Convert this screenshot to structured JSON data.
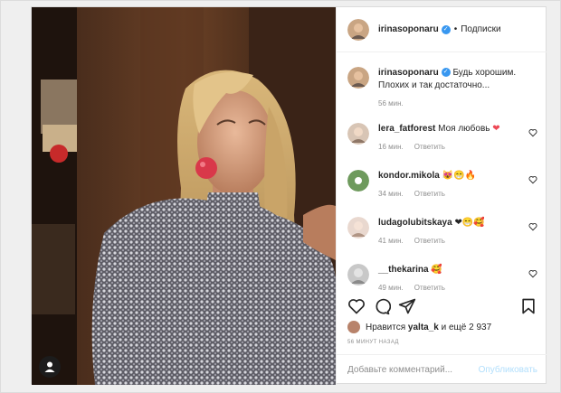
{
  "header": {
    "username": "irinasoponaru",
    "separator": "•",
    "follow_label": "Подписки"
  },
  "caption": {
    "username": "irinasoponaru",
    "text": "Будь хорошим. Плохих и так достаточно...",
    "time": "56 мин."
  },
  "comments": [
    {
      "username": "lera_fatforest",
      "text": "Моя любовь",
      "emoji": "❤",
      "time": "16 мин.",
      "reply": "Ответить"
    },
    {
      "username": "kondor.mikola",
      "text": "",
      "emoji": "😻😁🔥",
      "time": "34 мин.",
      "reply": "Ответить"
    },
    {
      "username": "ludagolubitskaya",
      "text": "",
      "emoji": "❤😁🥰",
      "time": "41 мин.",
      "reply": "Ответить"
    },
    {
      "username": "__thekarina",
      "text": "",
      "emoji": "🥰",
      "time": "49 мин.",
      "reply": "Ответить"
    }
  ],
  "likes": {
    "prefix": "Нравится",
    "user": "yalta_k",
    "suffix": "и ещё 2 937"
  },
  "time_ago": "56 МИНУТ НАЗАД",
  "add_comment": {
    "placeholder": "Добавьте комментарий...",
    "publish_label": "Опубликовать"
  },
  "colors": {
    "verified": "#3897f0",
    "heart": "#ed4956",
    "publish_disabled": "#b2dffc"
  }
}
